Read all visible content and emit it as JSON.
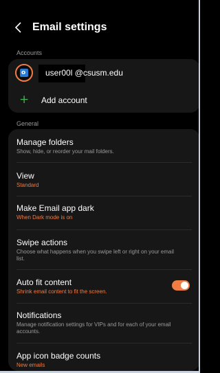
{
  "header": {
    "title": "Email settings"
  },
  "accounts": {
    "section_label": "Accounts",
    "items": [
      {
        "label": "user00l @csusm.edu",
        "icon": "outlook-icon"
      }
    ],
    "add_label": "Add account"
  },
  "general": {
    "section_label": "General",
    "items": [
      {
        "title": "Manage folders",
        "subtitle": "Show, hide, or reorder your mail folders."
      },
      {
        "title": "View",
        "subtitle": "Standard"
      },
      {
        "title": "Make Email app dark",
        "subtitle": "When Dark mode is on"
      },
      {
        "title": "Swipe actions",
        "subtitle": "Choose what happens when you swipe left or right on your email list."
      },
      {
        "title": "Auto fit content",
        "subtitle": "Shrink email content to fit the screen.",
        "toggle": true
      },
      {
        "title": "Notifications",
        "subtitle": "Manage notification settings for VIPs and for each of your email accounts."
      },
      {
        "title": "App icon badge counts",
        "subtitle": "New emails"
      }
    ]
  },
  "colors": {
    "accent": "#f07d43",
    "add_icon": "#3fb34f",
    "background": "#000000",
    "card": "#171717"
  }
}
